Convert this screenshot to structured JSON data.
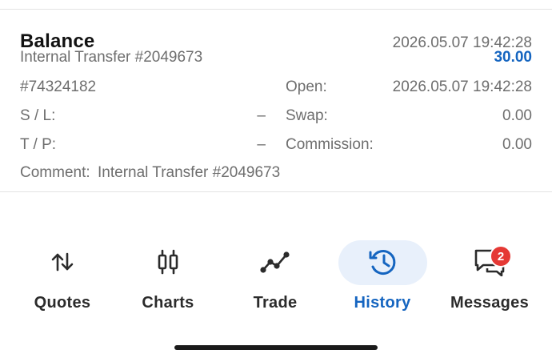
{
  "deal": {
    "title": "Balance",
    "time": "2026.05.07 19:42:28",
    "subtitle": "Internal Transfer #2049673",
    "amount": "30.00",
    "ticket": "#74324182",
    "open_label": "Open:",
    "open_value": "2026.05.07 19:42:28",
    "sl_label": "S / L:",
    "sl_value": "–",
    "swap_label": "Swap:",
    "swap_value": "0.00",
    "tp_label": "T / P:",
    "tp_value": "–",
    "commission_label": "Commission:",
    "commission_value": "0.00",
    "comment_label": "Comment:",
    "comment_value": "Internal Transfer #2049673"
  },
  "colors": {
    "accent": "#1565c0",
    "badge": "#e53935",
    "active_pill": "#e8f0fb"
  },
  "nav": {
    "items": [
      {
        "label": "Quotes",
        "icon": "sort-arrows-icon"
      },
      {
        "label": "Charts",
        "icon": "candlestick-icon"
      },
      {
        "label": "Trade",
        "icon": "trend-line-icon"
      },
      {
        "label": "History",
        "icon": "history-clock-icon",
        "active": true
      },
      {
        "label": "Messages",
        "icon": "chat-bubbles-icon",
        "badge": "2"
      }
    ]
  }
}
